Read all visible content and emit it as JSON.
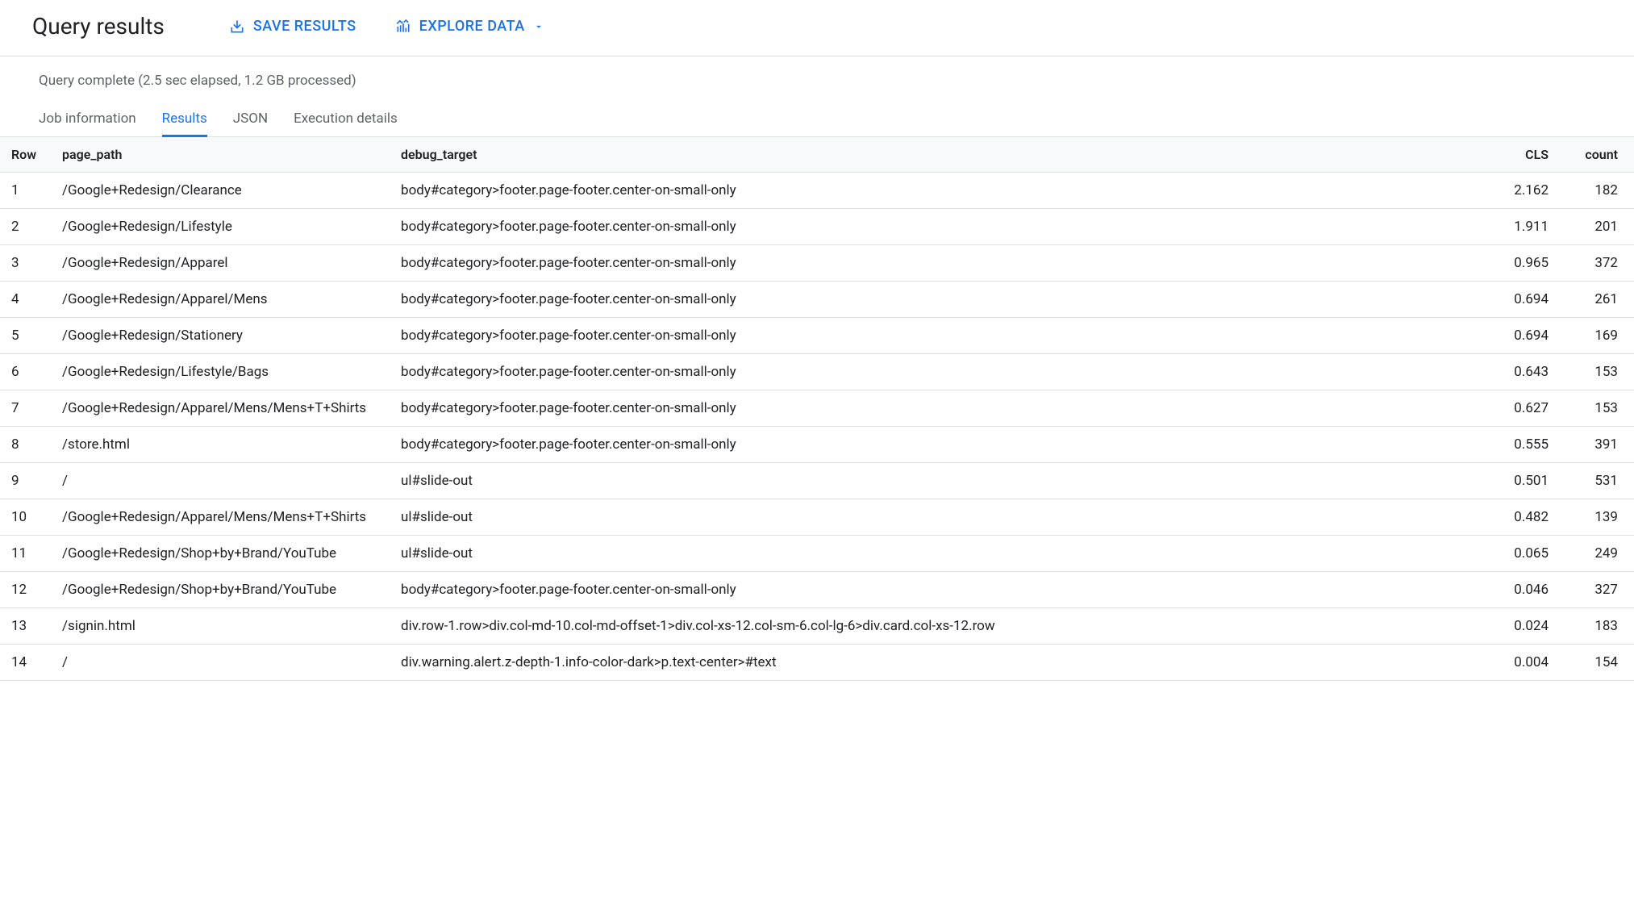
{
  "header": {
    "title": "Query results",
    "save_label": "SAVE RESULTS",
    "explore_label": "EXPLORE DATA"
  },
  "status": "Query complete (2.5 sec elapsed, 1.2 GB processed)",
  "tabs": [
    {
      "label": "Job information",
      "active": false
    },
    {
      "label": "Results",
      "active": true
    },
    {
      "label": "JSON",
      "active": false
    },
    {
      "label": "Execution details",
      "active": false
    }
  ],
  "table": {
    "columns": [
      "Row",
      "page_path",
      "debug_target",
      "CLS",
      "count"
    ],
    "rows": [
      {
        "row": "1",
        "page_path": "/Google+Redesign/Clearance",
        "debug_target": "body#category>footer.page-footer.center-on-small-only",
        "cls": "2.162",
        "count": "182"
      },
      {
        "row": "2",
        "page_path": "/Google+Redesign/Lifestyle",
        "debug_target": "body#category>footer.page-footer.center-on-small-only",
        "cls": "1.911",
        "count": "201"
      },
      {
        "row": "3",
        "page_path": "/Google+Redesign/Apparel",
        "debug_target": "body#category>footer.page-footer.center-on-small-only",
        "cls": "0.965",
        "count": "372"
      },
      {
        "row": "4",
        "page_path": "/Google+Redesign/Apparel/Mens",
        "debug_target": "body#category>footer.page-footer.center-on-small-only",
        "cls": "0.694",
        "count": "261"
      },
      {
        "row": "5",
        "page_path": "/Google+Redesign/Stationery",
        "debug_target": "body#category>footer.page-footer.center-on-small-only",
        "cls": "0.694",
        "count": "169"
      },
      {
        "row": "6",
        "page_path": "/Google+Redesign/Lifestyle/Bags",
        "debug_target": "body#category>footer.page-footer.center-on-small-only",
        "cls": "0.643",
        "count": "153"
      },
      {
        "row": "7",
        "page_path": "/Google+Redesign/Apparel/Mens/Mens+T+Shirts",
        "debug_target": "body#category>footer.page-footer.center-on-small-only",
        "cls": "0.627",
        "count": "153"
      },
      {
        "row": "8",
        "page_path": "/store.html",
        "debug_target": "body#category>footer.page-footer.center-on-small-only",
        "cls": "0.555",
        "count": "391"
      },
      {
        "row": "9",
        "page_path": "/",
        "debug_target": "ul#slide-out",
        "cls": "0.501",
        "count": "531"
      },
      {
        "row": "10",
        "page_path": "/Google+Redesign/Apparel/Mens/Mens+T+Shirts",
        "debug_target": "ul#slide-out",
        "cls": "0.482",
        "count": "139"
      },
      {
        "row": "11",
        "page_path": "/Google+Redesign/Shop+by+Brand/YouTube",
        "debug_target": "ul#slide-out",
        "cls": "0.065",
        "count": "249"
      },
      {
        "row": "12",
        "page_path": "/Google+Redesign/Shop+by+Brand/YouTube",
        "debug_target": "body#category>footer.page-footer.center-on-small-only",
        "cls": "0.046",
        "count": "327"
      },
      {
        "row": "13",
        "page_path": "/signin.html",
        "debug_target": "div.row-1.row>div.col-md-10.col-md-offset-1>div.col-xs-12.col-sm-6.col-lg-6>div.card.col-xs-12.row",
        "cls": "0.024",
        "count": "183"
      },
      {
        "row": "14",
        "page_path": "/",
        "debug_target": "div.warning.alert.z-depth-1.info-color-dark>p.text-center>#text",
        "cls": "0.004",
        "count": "154"
      }
    ]
  }
}
